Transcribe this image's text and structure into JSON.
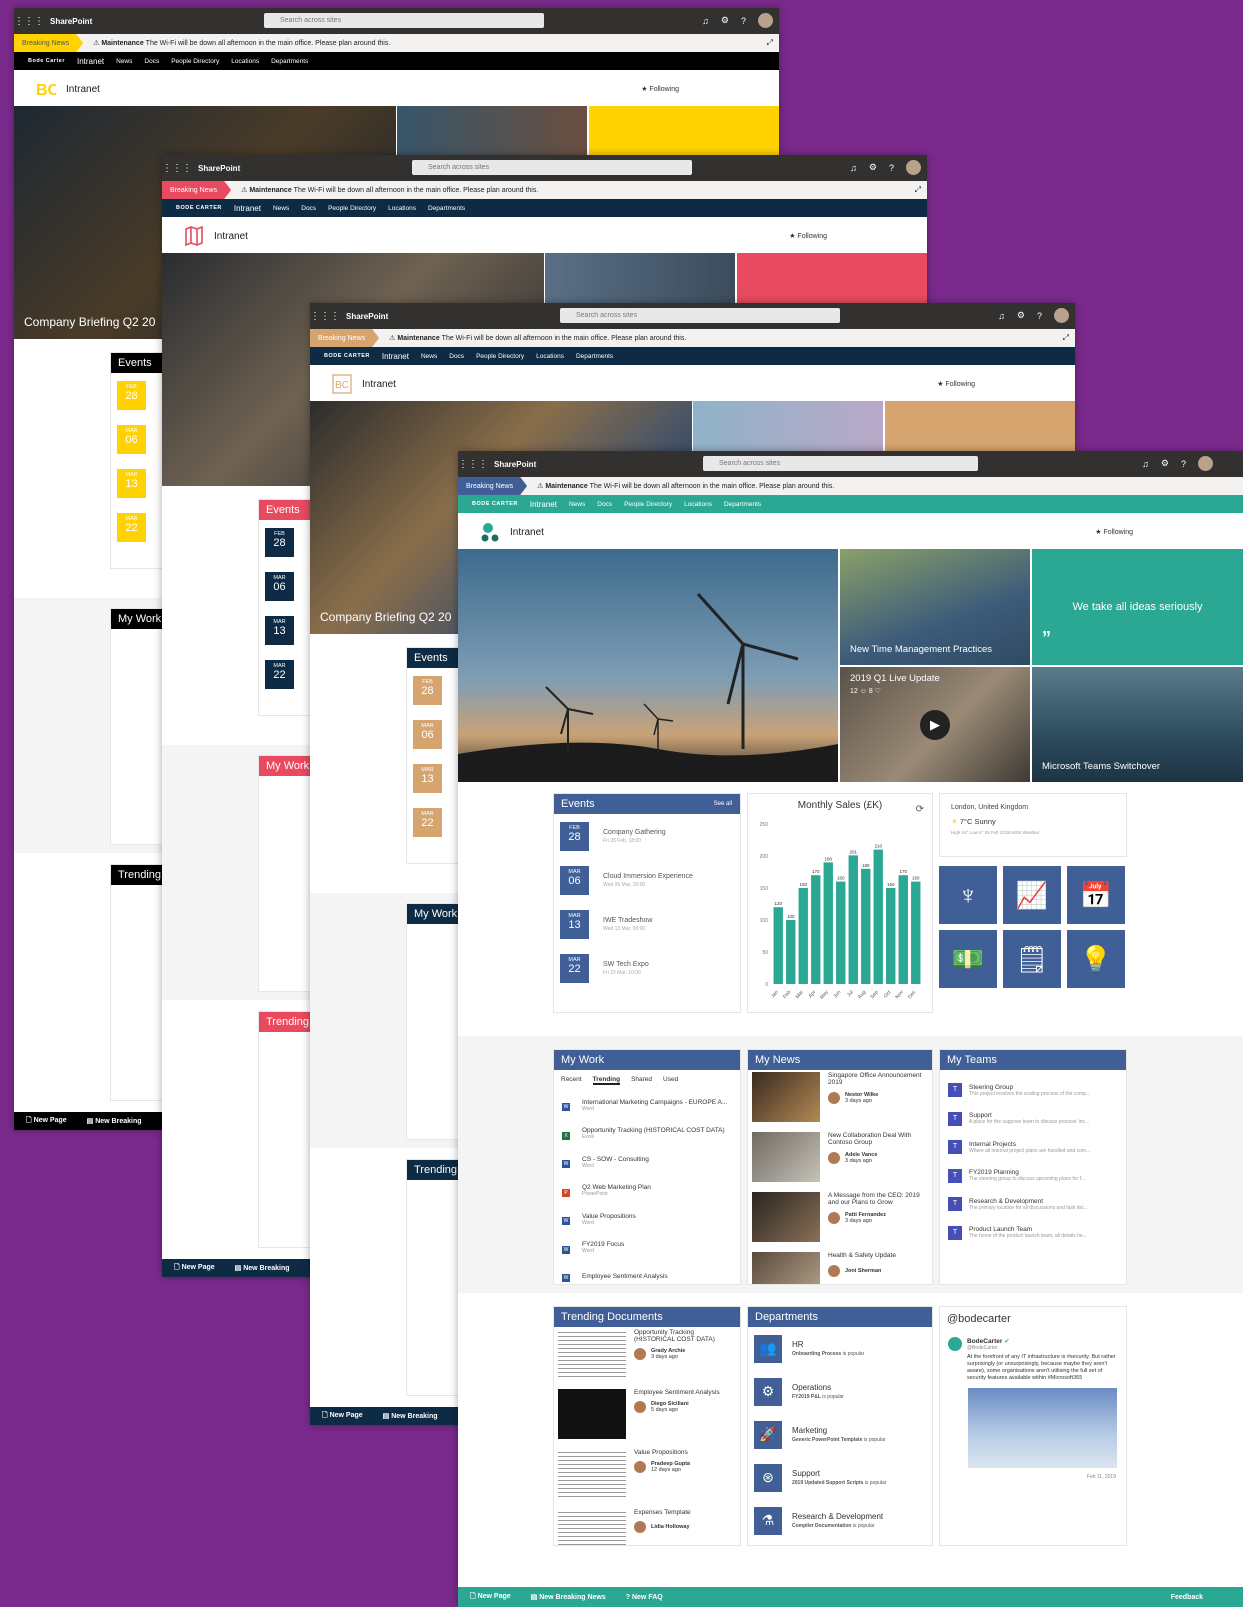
{
  "common": {
    "app_name": "SharePoint",
    "search_placeholder": "Search across sites",
    "breaking_news": "Breaking News",
    "maintenance_label": "Maintenance",
    "maintenance_text": "The Wi-Fi will be down all afternoon in the main office. Please plan around this.",
    "hub_nav": [
      "Intranet",
      "News",
      "Docs",
      "People Directory",
      "Locations",
      "Departments"
    ],
    "site_title": "Intranet",
    "following": "Following",
    "quote": "We take all ideas seriously",
    "company_briefing": "Company Briefing Q2 20",
    "events_title": "Events",
    "my_work_title": "My Work",
    "trending_title": "Trending",
    "new_page": "New Page",
    "new_breaking": "New Breaking"
  },
  "brands": {
    "w1": "Bode Carter",
    "w2": "BODE CARTER",
    "w3": "BODE CARTER",
    "w4": "BODE CARTER"
  },
  "colors": {
    "w1": "#ffd200",
    "w2": "#e84a5f",
    "w3": "#d6a56f",
    "w4": "#2ba894",
    "w4_section": "#3f5f96",
    "navy": "#0d2b45"
  },
  "hero": {
    "tile_1": "New Time Management Practices",
    "tile_2": "2019 Q1 Live Update",
    "tile_2_meta": "12 ☺ 8 ♡",
    "tile_3": "Microsoft Teams Switchover"
  },
  "events": {
    "see_all": "See all",
    "items": [
      {
        "month": "FEB",
        "day": "28",
        "title": "Company Gathering",
        "sub": "Fri 28 Feb, 18:00"
      },
      {
        "month": "MAR",
        "day": "06",
        "title": "Cloud Immersion Experience",
        "sub": "Wed 06 Mar, 10:00"
      },
      {
        "month": "MAR",
        "day": "13",
        "title": "IWE Tradeshow",
        "sub": "Wed 13 Mar, 09:00"
      },
      {
        "month": "MAR",
        "day": "22",
        "title": "SW Tech Expo",
        "sub": "Fri 22 Mar, 10:00"
      }
    ]
  },
  "weather": {
    "location": "London, United Kingdom",
    "temp": "7°C Sunny",
    "details": "High 16° Low 5° 25 Feb 2019 MSN Weather"
  },
  "chart_data": {
    "type": "bar",
    "title": "Monthly Sales (£K)",
    "categories": [
      "Jan",
      "Feb",
      "Mar",
      "Apr",
      "May",
      "Jun",
      "Jul",
      "Aug",
      "Sep",
      "Oct",
      "Nov",
      "Dec"
    ],
    "values": [
      120,
      100,
      150,
      170,
      190,
      160,
      201,
      180,
      210,
      150,
      170,
      160
    ],
    "ylim": [
      0,
      250
    ],
    "yticks": [
      0,
      50,
      100,
      150,
      200,
      250
    ],
    "color": "#2ba894"
  },
  "my_work": {
    "tabs": [
      "Recent",
      "Trending",
      "Shared",
      "Used"
    ],
    "docs": [
      {
        "name": "International Marketing Campaigns - EUROPE A...",
        "type": "Word",
        "icon": "W",
        "color": "#2b579a"
      },
      {
        "name": "Opportunity Tracking (HISTORICAL COST DATA)",
        "type": "Excel",
        "icon": "X",
        "color": "#217346"
      },
      {
        "name": "CS - SOW - Consulting",
        "type": "Word",
        "icon": "W",
        "color": "#2b579a"
      },
      {
        "name": "Q2 Web Marketing Plan",
        "type": "PowerPoint",
        "icon": "P",
        "color": "#d24726"
      },
      {
        "name": "Value Propositions",
        "type": "Word",
        "icon": "W",
        "color": "#2b579a"
      },
      {
        "name": "FY2019 Focus",
        "type": "Word",
        "icon": "W",
        "color": "#2b579a"
      },
      {
        "name": "Employee Sentiment Analysis",
        "type": "",
        "icon": "W",
        "color": "#2b579a"
      }
    ]
  },
  "my_news": {
    "title": "My News",
    "items": [
      {
        "title": "Singapore Office Announcement 2019",
        "author": "Nestor Wilke",
        "when": "3 days ago"
      },
      {
        "title": "New Collaboration Deal With Contoso Group",
        "author": "Adele Vance",
        "when": "3 days ago"
      },
      {
        "title": "A Message from the CEO: 2019 and our Plans to Grow",
        "author": "Patti Fernandez",
        "when": "3 days ago"
      },
      {
        "title": "Health & Safety Update",
        "author": "Joni Sherman",
        "when": ""
      }
    ]
  },
  "my_teams": {
    "title": "My Teams",
    "items": [
      {
        "name": "Steering Group",
        "desc": "This project involves the scaling process of the comp..."
      },
      {
        "name": "Support",
        "desc": "A place for the suppose team to discuss process' inc..."
      },
      {
        "name": "Internal Projects",
        "desc": "Where all internal project plans are handled and com..."
      },
      {
        "name": "FY2019 Planning",
        "desc": "The steering group to discuss upcoming plans for f..."
      },
      {
        "name": "Research & Development",
        "desc": "The primary location for all discussions and task list..."
      },
      {
        "name": "Product Launch Team",
        "desc": "The home of the product launch team, all details he..."
      }
    ]
  },
  "trending_docs": {
    "title": "Trending Documents",
    "items": [
      {
        "title": "Opportunity Tracking (HISTORICAL COST DATA)",
        "author": "Grady Archie",
        "when": "3 days ago"
      },
      {
        "title": "Employee Sentiment Analysis",
        "author": "Diego Siciliani",
        "when": "5 days ago"
      },
      {
        "title": "Value Propositions",
        "author": "Pradeep Gupta",
        "when": "12 days ago"
      },
      {
        "title": "Expenses Template",
        "author": "Lidia Holloway",
        "when": ""
      }
    ]
  },
  "departments": {
    "title": "Departments",
    "items": [
      {
        "name": "HR",
        "popular": "Onboarding Process",
        "suffix": "is popular"
      },
      {
        "name": "Operations",
        "popular": "FY2019 P&L",
        "suffix": "is popular"
      },
      {
        "name": "Marketing",
        "popular": "Generic PowerPoint Template",
        "suffix": "is popular"
      },
      {
        "name": "Support",
        "popular": "2019 Updated Support Scripts",
        "suffix": "is popular"
      },
      {
        "name": "Research & Development",
        "popular": "Compiler Documentation",
        "suffix": "is popular"
      }
    ]
  },
  "twitter": {
    "handle_title": "@bodecarter",
    "name": "BodeCarter",
    "handle": "@BodeCarter",
    "text": "At the forefront of any IT infrastructure is #security. But rather surprisingly (or unsurprisingly, because maybe they aren't aware), some organisations aren't utilising the full set of security features available within #Microsoft365",
    "date": "Feb 11, 2019"
  },
  "footer": {
    "new_page": "New Page",
    "new_breaking_news": "New Breaking News",
    "new_faq": "New FAQ",
    "feedback": "Feedback"
  }
}
